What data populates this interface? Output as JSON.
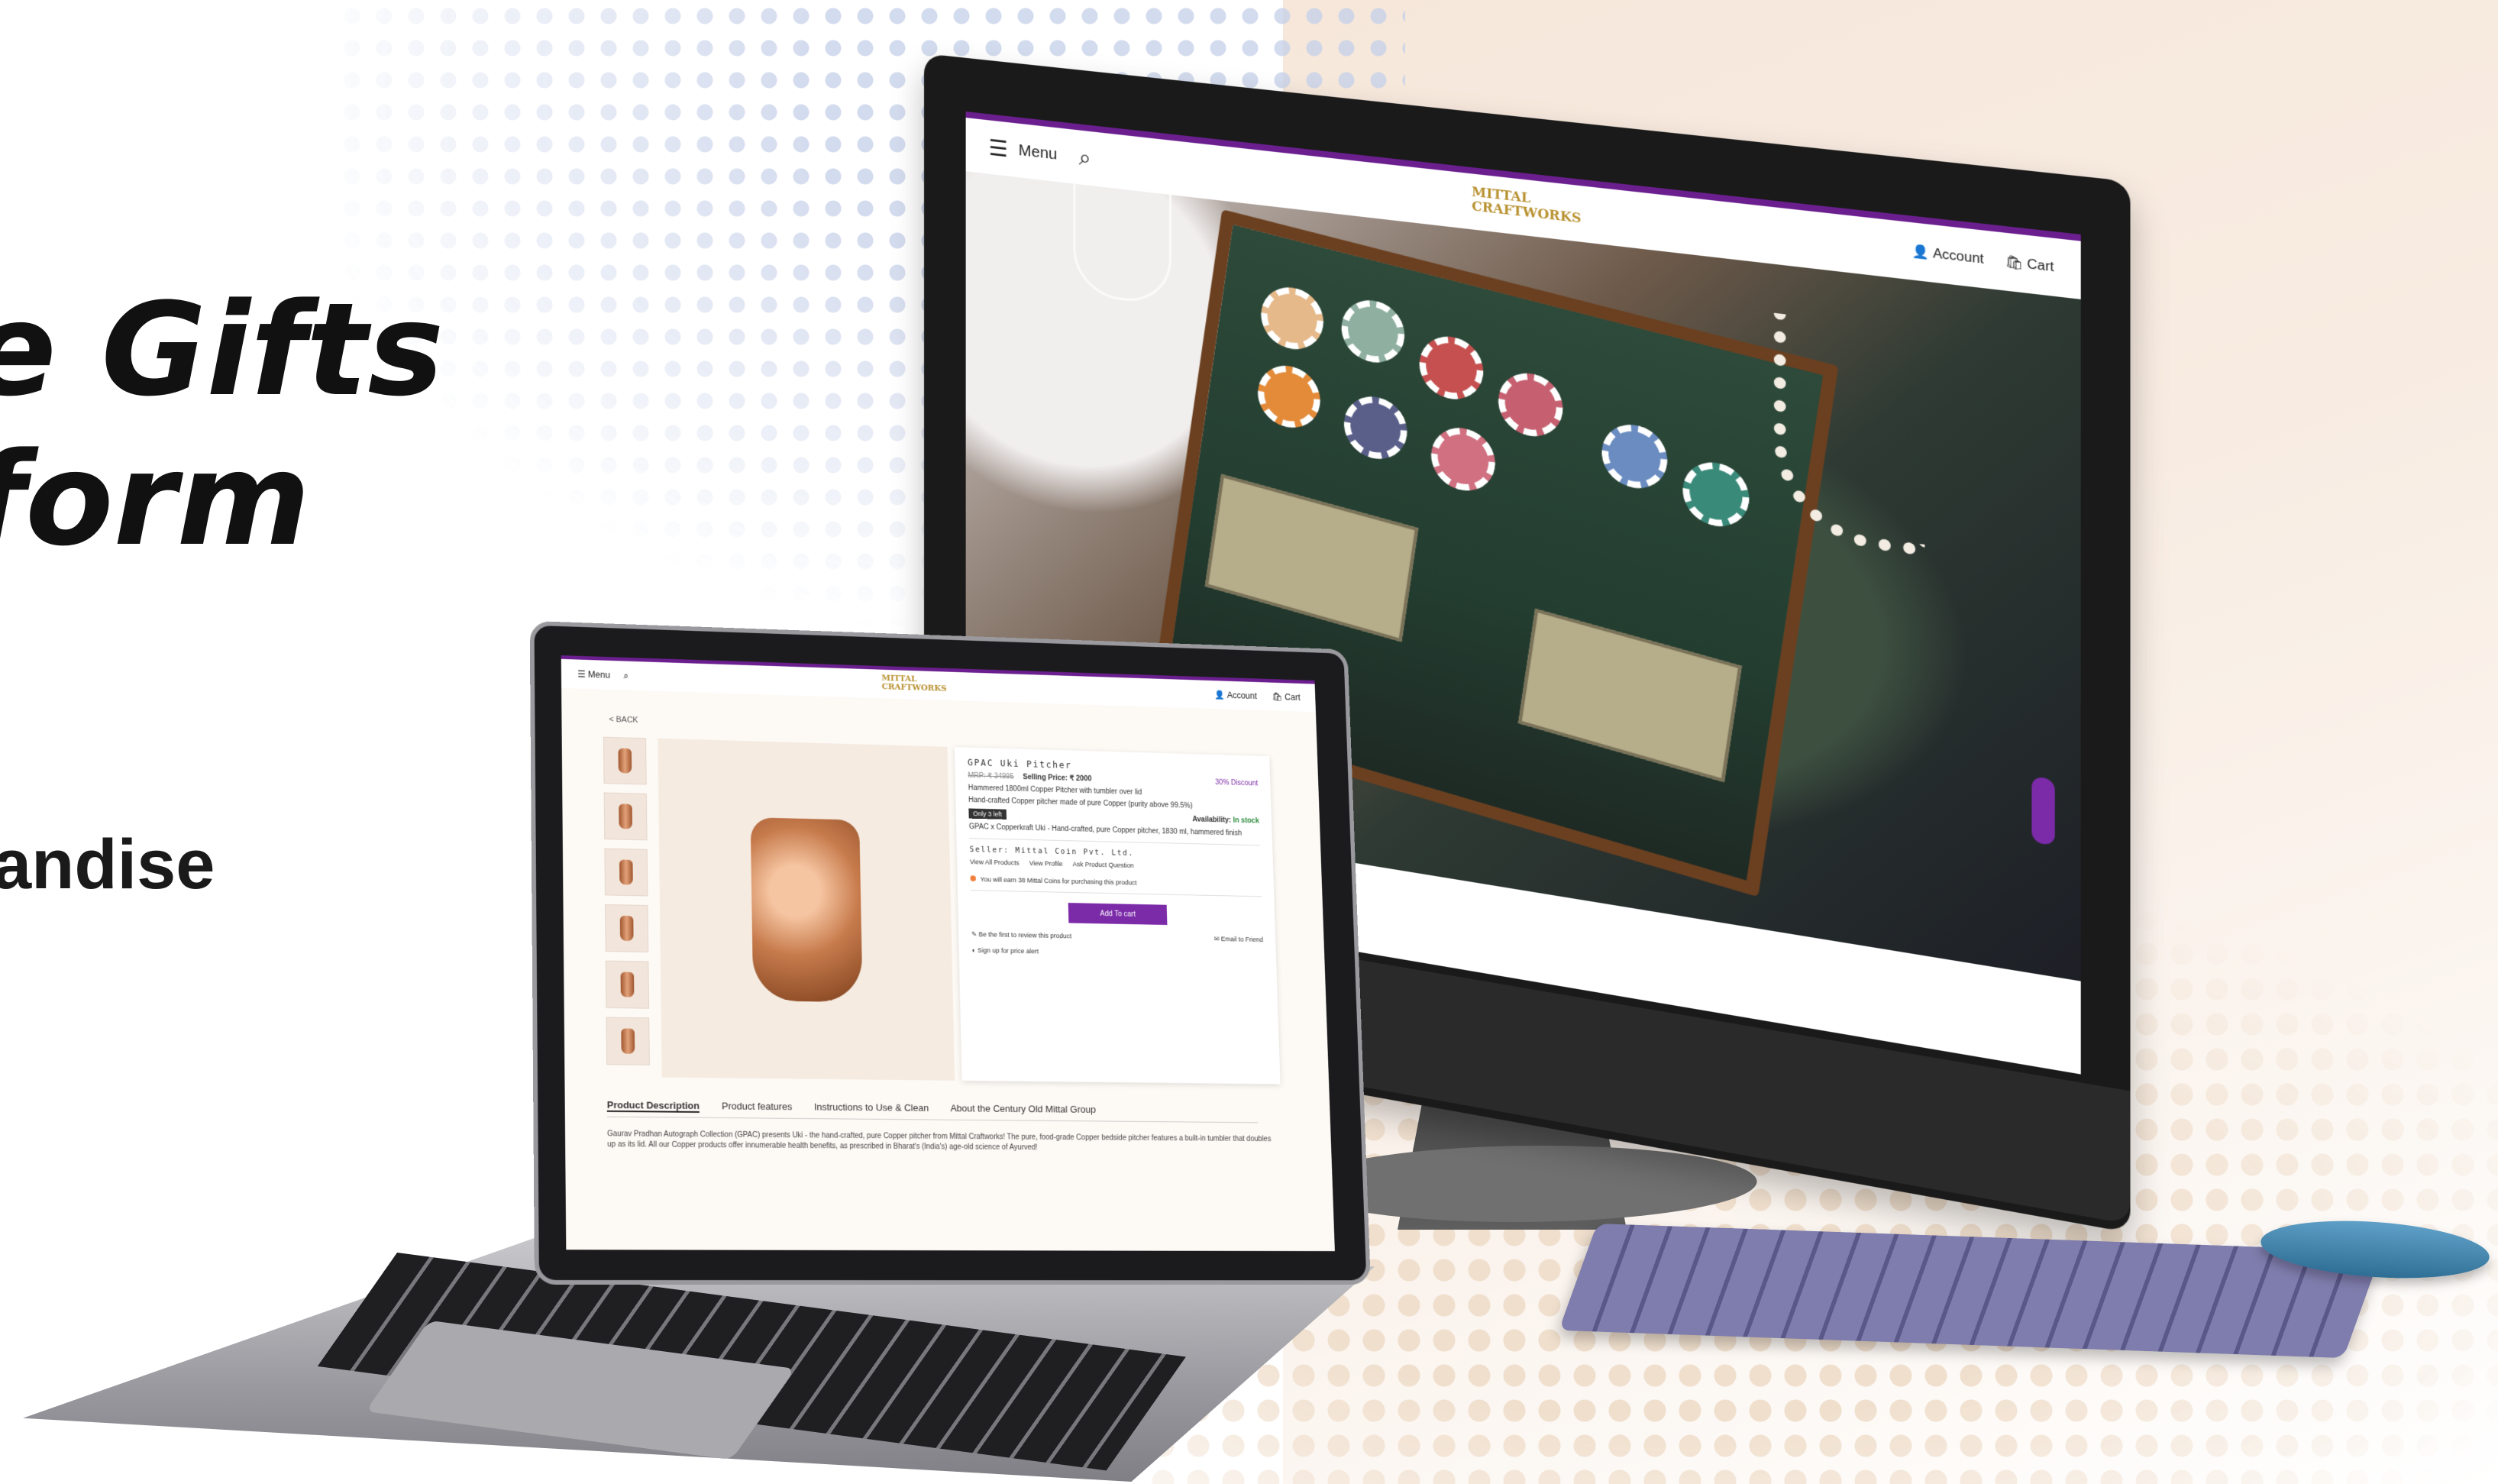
{
  "hero_text": {
    "headline": "e Gifts\nform",
    "subline": "andise"
  },
  "desktop_site": {
    "menu_label": "Menu",
    "brand": "MITTAL\nCRAFTWORKS",
    "account_label": "Account",
    "cart_label": "Cart"
  },
  "laptop_site": {
    "menu_label": "Menu",
    "brand": "MITTAL\nCRAFTWORKS",
    "account_label": "Account",
    "cart_label": "Cart",
    "back_label": "< BACK",
    "product": {
      "title": "GPAC Uki Pitcher",
      "mrp": "MRP: ₹ 34995",
      "selling_price": "Selling Price: ₹ 2000",
      "discount": "30% Discount",
      "short_desc": "Hammered 1800ml Copper Pitcher with tumbler over lid",
      "material": "Hand-crafted Copper pitcher made of pure Copper (purity above 99.5%)",
      "stock_badge": "Only 3 left",
      "availability_label": "Availability:",
      "availability_value": "In stock",
      "spec": "GPAC x Copperkraft Uki - Hand-crafted, pure Copper pitcher, 1830 ml, hammered finish",
      "seller": "Seller: Mittal Coin Pvt. Ltd.",
      "links": [
        "View All Products",
        "View Profile",
        "Ask Product Question"
      ],
      "coins_note": "You will earn 38 Mittal Coins for purchasing this product",
      "add_to_cart": "Add To cart",
      "review_note": "Be the first to review this product",
      "email_friend": "Email to Friend",
      "price_alert": "Sign up for price alert"
    },
    "tabs": [
      "Product Description",
      "Product features",
      "Instructions to Use & Clean",
      "About the Century Old Mittal Group"
    ],
    "description": "Gaurav Pradhan Autograph Collection (GPAC) presents Uki - the hand-crafted, pure Copper pitcher from Mittal Craftworks! The pure, food-grade Copper bedside pitcher features a built-in tumbler that doubles up as its lid. All our Copper products offer innumerable health benefits, as prescribed in Bharat's (India's) age-old science of Ayurved!"
  }
}
